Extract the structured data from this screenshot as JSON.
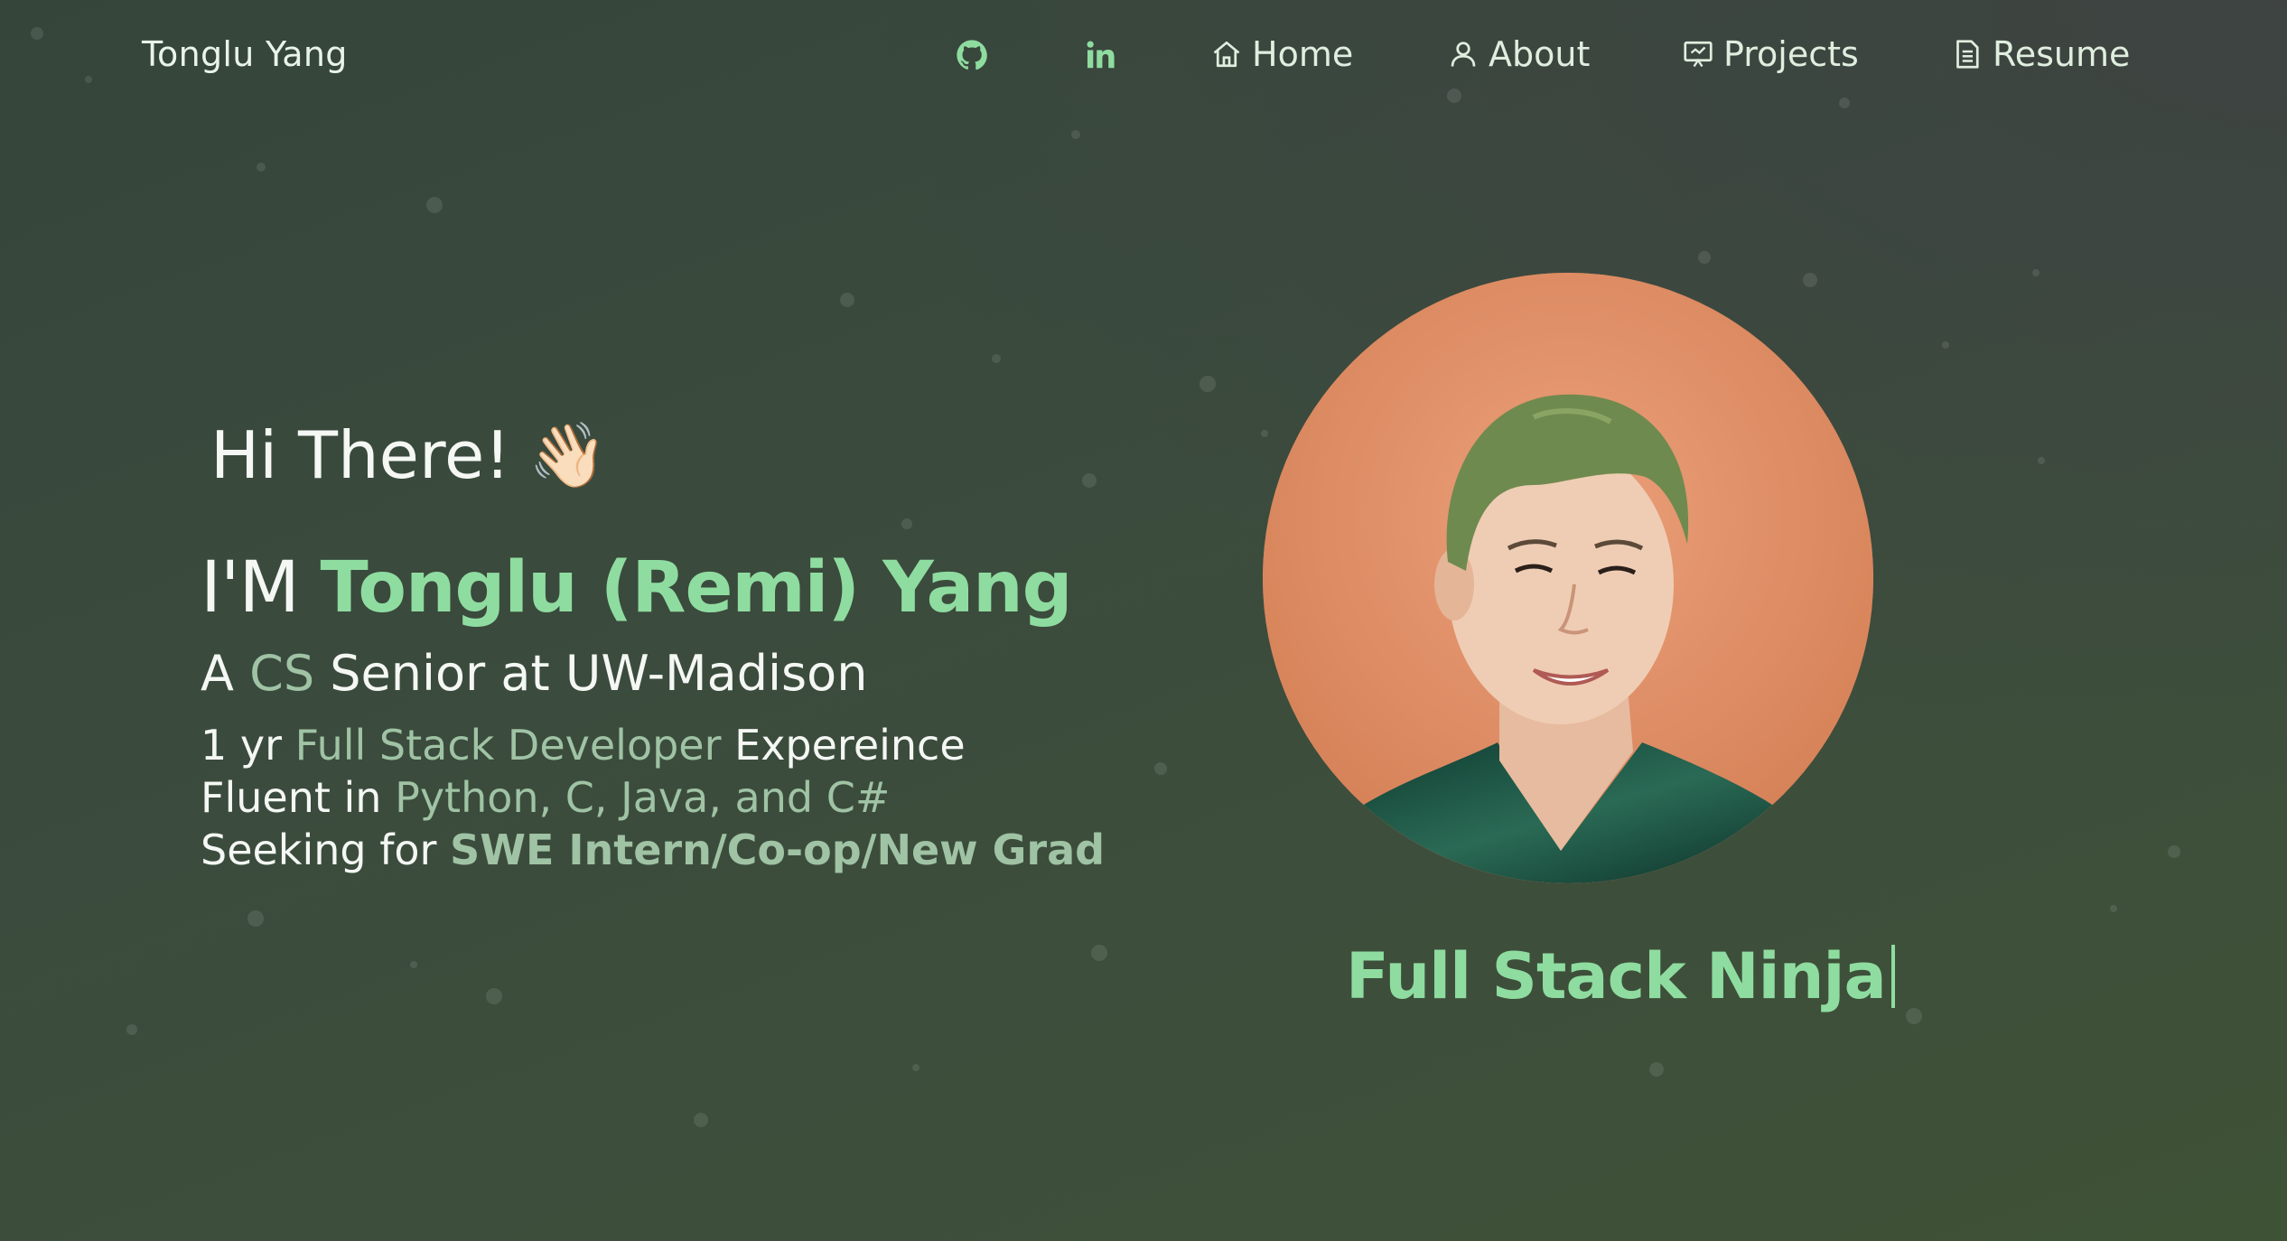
{
  "navbar": {
    "brand": "Tonglu Yang",
    "icons": [
      "github-icon",
      "linkedin-icon"
    ],
    "items": [
      {
        "label": "Home",
        "icon": "home-icon"
      },
      {
        "label": "About",
        "icon": "user-icon"
      },
      {
        "label": "Projects",
        "icon": "presentation-icon"
      },
      {
        "label": "Resume",
        "icon": "document-icon"
      }
    ]
  },
  "hero": {
    "greeting": "Hi There!",
    "wave_emoji": "👋🏻",
    "im_prefix": "I'M",
    "name": "Tonglu (Remi) Yang",
    "subtitle": {
      "pre": "A",
      "highlight": "CS",
      "post": "Senior at UW-Madison"
    },
    "lines": [
      {
        "pre": "1 yr",
        "highlight": "Full Stack Developer",
        "post": "Expereince"
      },
      {
        "pre": "Fluent in",
        "highlight": "Python, C, Java, and C#",
        "post": ""
      },
      {
        "pre": "Seeking for",
        "highlight": "SWE Intern/Co-op/New Grad",
        "post": ""
      }
    ],
    "typewriter_text": "Full Stack Ninja"
  },
  "colors": {
    "accent": "#8fdca0",
    "muted_accent": "#9fc3a4",
    "background": "#3a4a3d",
    "avatar_bg": "#dd8a5e"
  }
}
